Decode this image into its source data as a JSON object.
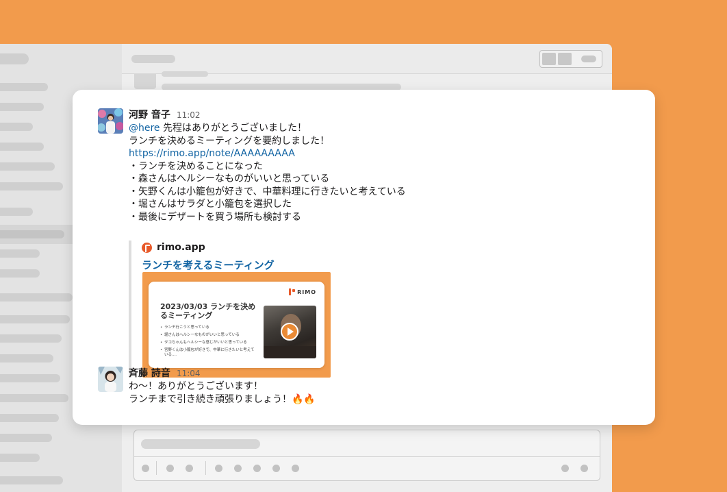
{
  "messages": [
    {
      "name": "河野 音子",
      "time": "11:02",
      "mention": "@here",
      "lines": [
        "先程はありがとうございました！",
        "ランチを決めるミーティングを要約しました！",
        "https://rimo.app/note/AAAAAAAAA",
        "・ランチを決めることになった",
        "・森さんはヘルシーなものがいいと思っている",
        "・矢野くんは小籠包が好きで、中華料理に行きたいと考えている",
        "・堀さんはサラダと小籠包を選択した",
        "・最後にデザートを買う場所も検討する"
      ]
    },
    {
      "name": "斉藤 詩音",
      "time": "11:04",
      "lines": [
        "わ〜！ありがとうございます！",
        "ランチまで引き続き頑張りましょう！🔥🔥"
      ]
    }
  ],
  "unfurl": {
    "site": "rimo.app",
    "title": "ランチを考えるミーティング",
    "preview_logo": "RIMO",
    "preview_title": "2023/03/03 ランチを決めるミーティング",
    "preview_items": [
      "ランチ行こうと思っている",
      "堀さんはヘルシーなものがいいと思っている",
      "タコちゃんもヘルシーな感じがいいと思っている",
      "宮野くんは小籠包が好きで、中華に行きたいと考えている...."
    ]
  },
  "colors": {
    "background": "#F29B4C",
    "link": "#1264A3",
    "brand": "#E85A2A"
  },
  "icons": {
    "site": "rimo-icon",
    "play": "play-icon"
  }
}
